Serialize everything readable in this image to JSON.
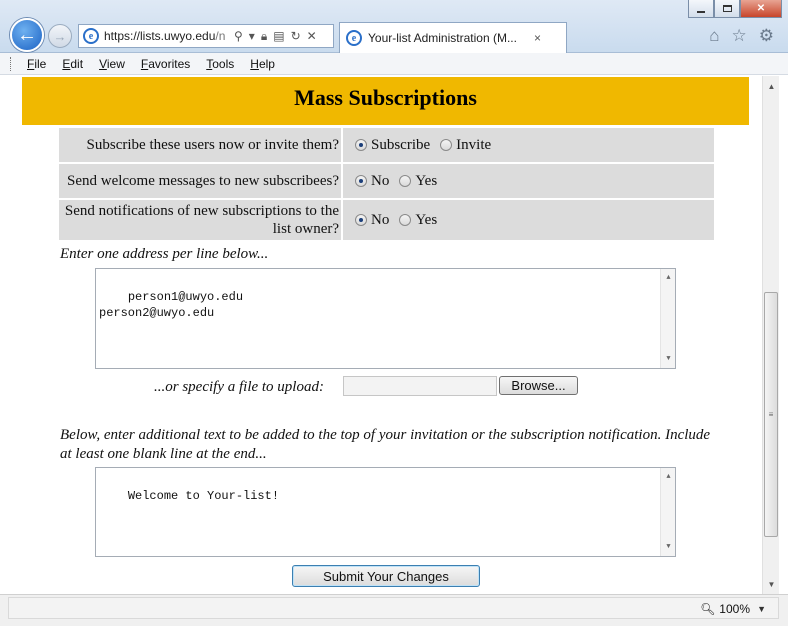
{
  "browser": {
    "url_host": "https://lists.uwyo.edu",
    "url_rest": "/n",
    "tab_title": "Your-list Administration (M...",
    "tab_close": "×",
    "menu": [
      "File",
      "Edit",
      "View",
      "Favorites",
      "Tools",
      "Help"
    ],
    "zoom": "100%"
  },
  "page": {
    "heading": "Mass Subscriptions",
    "options": [
      {
        "label": "Subscribe these users now or invite them?",
        "choices": [
          "Subscribe",
          "Invite"
        ],
        "selected": 0
      },
      {
        "label": "Send welcome messages to new subscribees?",
        "choices": [
          "No",
          "Yes"
        ],
        "selected": 0
      },
      {
        "label": "Send notifications of new subscriptions to the list owner?",
        "choices": [
          "No",
          "Yes"
        ],
        "selected": 0
      }
    ],
    "address_prompt": "Enter one address per line below...",
    "addresses": "person1@uwyo.edu\nperson2@uwyo.edu",
    "file_prompt": "...or specify a file to upload:",
    "browse_label": "Browse...",
    "invite_prompt": "Below, enter additional text to be added to the top of your invitation or the subscription notification. Include at least one blank line at the end...",
    "invite_text": "Welcome to Your-list!",
    "submit_label": "Submit Your Changes"
  }
}
